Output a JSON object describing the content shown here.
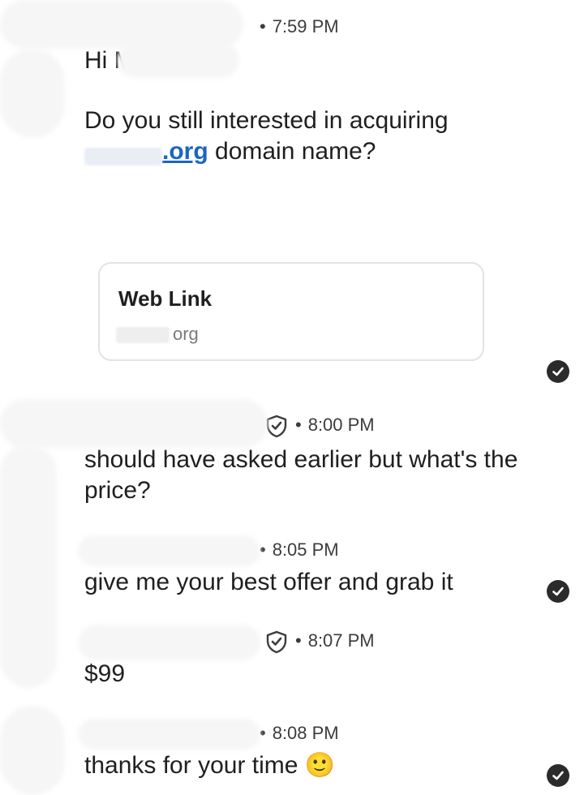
{
  "messages": [
    {
      "time": "7:59 PM",
      "greeting": "Hi Mr",
      "body_prefix": "Do you still interested in acquiring",
      "link_text": ".org",
      "body_suffix": " domain name?"
    },
    {
      "time": "8:00 PM",
      "text": "should have asked earlier but what's the price?"
    },
    {
      "time": "8:05 PM",
      "text": "give me your best offer and grab it"
    },
    {
      "time": "8:07 PM",
      "text": "$99"
    },
    {
      "time": "8:08 PM",
      "text": "thanks for your time",
      "emoji": "🙂"
    }
  ],
  "link_card": {
    "title": "Web Link",
    "domain": "org"
  },
  "icons": {
    "read_receipt": "check-circle-icon",
    "verified": "shield-check-icon"
  },
  "colors": {
    "link": "#1a66c2",
    "text": "#1f1f1f",
    "meta": "#3c3c3c"
  }
}
